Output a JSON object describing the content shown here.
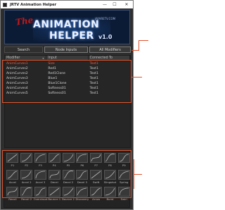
{
  "window": {
    "title": "JRTV Animation Helper",
    "minimize": "—",
    "maximize": "☐",
    "close": "✕"
  },
  "banner": {
    "the": "The",
    "line1": "ANIMATION",
    "line2": "HELPER",
    "version": "v1.0",
    "site": "JAYARETV.COM"
  },
  "tabs": {
    "search": "Search",
    "node_inputs": "Node Inputs",
    "all_modifiers": "All Modifiers"
  },
  "table": {
    "headers": [
      "Modifier",
      "Input",
      "Connected To"
    ],
    "rows": [
      [
        "AnimCurves1",
        "Size",
        "Text1"
      ],
      [
        "AnimCurves2",
        "Red1",
        "Text1"
      ],
      [
        "AnimCurves2",
        "Red1Clone",
        "Text1"
      ],
      [
        "AnimCurves3",
        "Blue1",
        "Text1"
      ],
      [
        "AnimCurves3",
        "Blue1Clone",
        "Text1"
      ],
      [
        "AnimCurves4",
        "Softness01",
        "Text1"
      ],
      [
        "AnimCurves5",
        "Softness01",
        "Text1"
      ]
    ],
    "selected_row": 0
  },
  "presets": {
    "row1": [
      "P1",
      "P2",
      "P3",
      "P4",
      "P5",
      "P6",
      "P7",
      "P8",
      "P9"
    ],
    "row2": [
      "Accel",
      "Accel 2",
      "Accel 3",
      "Decel",
      "Decel 2",
      "Decel 3",
      "Swift",
      "Slingshot",
      "Spring"
    ],
    "row3": [
      "Recoil",
      "Recoil 2",
      "Overshoot",
      "Bounce 1",
      "Bounce 2",
      "Discovery",
      "Arrow",
      "Burst",
      "Swirl"
    ]
  },
  "colors": {
    "accent": "#e0542e",
    "selected_text": "#ff5a3c",
    "banner_red": "#c01818"
  }
}
